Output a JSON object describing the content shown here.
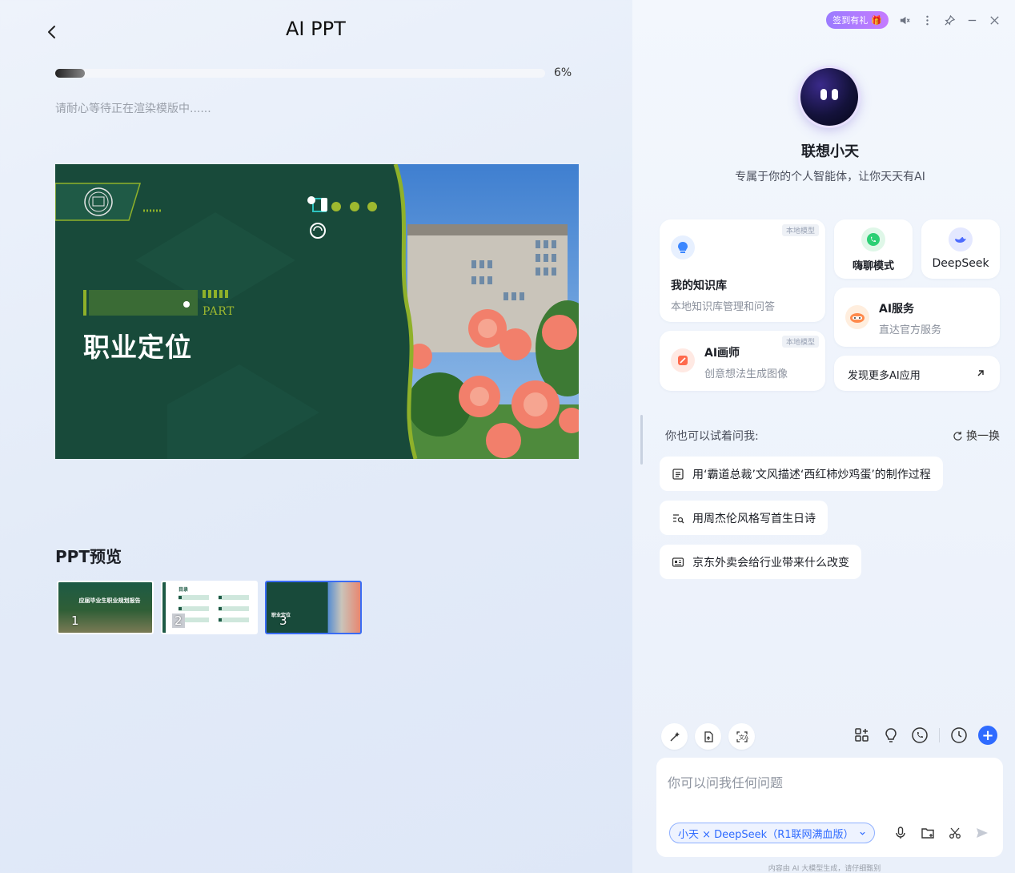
{
  "header": {
    "title": "AI PPT"
  },
  "progress": {
    "percent_label": "6%",
    "value": 0.06,
    "status": "请耐心等待正在渲染模版中......"
  },
  "slide": {
    "part": "PART",
    "title": "职业定位"
  },
  "preview": {
    "heading": "PPT预览",
    "thumbs": [
      {
        "num": "1",
        "label": "应届毕业生职业规划报告"
      },
      {
        "num": "2",
        "label": "目录"
      },
      {
        "num": "3",
        "label": "职业定位"
      }
    ]
  },
  "topbar": {
    "checkin": "签到有礼"
  },
  "agent": {
    "name": "联想小天",
    "subtitle": "专属于你的个人智能体，让你天天有AI"
  },
  "cards": {
    "knowledge": {
      "tag": "本地模型",
      "title": "我的知识库",
      "desc": "本地知识库管理和问答"
    },
    "chat": {
      "title": "嗨聊模式"
    },
    "deepseek": {
      "title": "DeepSeek"
    },
    "draw": {
      "tag": "本地模型",
      "title": "AI画师",
      "desc": "创意想法生成图像"
    },
    "service": {
      "title": "AI服务",
      "desc": "直达官方服务"
    },
    "more": {
      "title": "发现更多AI应用"
    }
  },
  "suggestions": {
    "label": "你也可以试着问我:",
    "refresh": "换一换",
    "items": [
      "用‘霸道总裁’文风描述‘西红柿炒鸡蛋’的制作过程",
      "用周杰伦风格写首生日诗",
      "京东外卖会给行业带来什么改变"
    ]
  },
  "composer": {
    "placeholder": "你可以问我任何问题",
    "model_chip": "小天 × DeepSeek（R1联网满血版）"
  },
  "footer": {
    "disclaimer": "内容由 AI 大模型生成，请仔细甄别"
  },
  "colors": {
    "accent": "#2f6bff",
    "slide_green": "#184a3a",
    "slide_lime": "#9fb92f"
  }
}
